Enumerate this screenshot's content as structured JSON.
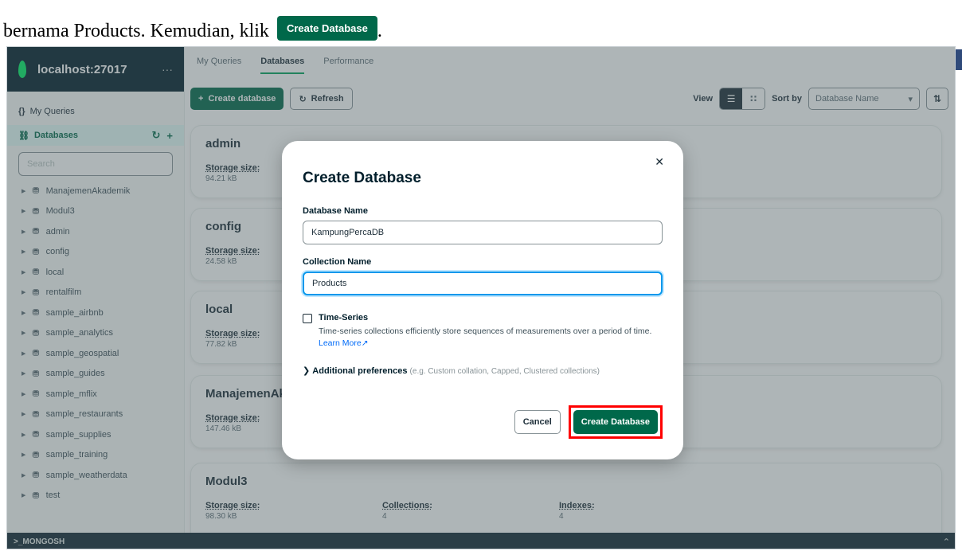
{
  "doc": {
    "line1": "",
    "line2_text": "bernama Products. Kemudian, klik",
    "inline_button": "Create Database",
    "line2_end": "."
  },
  "sidebar": {
    "connection": "localhost:27017",
    "connection_more": "···",
    "my_queries": "My Queries",
    "databases_label": "Databases",
    "search_placeholder": "Search",
    "databases": [
      "ManajemenAkademik",
      "Modul3",
      "admin",
      "config",
      "local",
      "rentalfilm",
      "sample_airbnb",
      "sample_analytics",
      "sample_geospatial",
      "sample_guides",
      "sample_mflix",
      "sample_restaurants",
      "sample_supplies",
      "sample_training",
      "sample_weatherdata",
      "test"
    ]
  },
  "tabs": [
    "My Queries",
    "Databases",
    "Performance"
  ],
  "toolbar": {
    "create": "Create database",
    "refresh": "Refresh",
    "view_label": "View",
    "sort_label": "Sort by",
    "sort_value": "Database Name"
  },
  "cards": [
    {
      "name": "admin",
      "storage_label": "Storage size:",
      "storage": "94.21 kB"
    },
    {
      "name": "config",
      "storage_label": "Storage size:",
      "storage": "24.58 kB"
    },
    {
      "name": "local",
      "storage_label": "Storage size:",
      "storage": "77.82 kB"
    },
    {
      "name": "ManajemenAk",
      "storage_label": "Storage size:",
      "storage": "147.46 kB"
    },
    {
      "name": "Modul3",
      "storage_label": "Storage size:",
      "storage": "98.30 kB",
      "collections_label": "Collections:",
      "collections": "4",
      "indexes_label": "Indexes:",
      "indexes": "4"
    }
  ],
  "mongosh": ">_MONGOSH",
  "modal": {
    "title": "Create Database",
    "db_name_label": "Database Name",
    "db_name_value": "KampungPercaDB",
    "coll_name_label": "Collection Name",
    "coll_name_value": "Products",
    "timeseries_label": "Time-Series",
    "timeseries_desc": "Time-series collections efficiently store sequences of measurements over a period of time.",
    "learn_more": "Learn More",
    "additional_label": "Additional preferences",
    "additional_hint": "(e.g. Custom collation, Capped, Clustered collections)",
    "cancel": "Cancel",
    "create": "Create Database"
  },
  "colors": {
    "brand_green": "#00684a",
    "leaf_green": "#00ed64",
    "dark_navy": "#001e2b",
    "highlight_red": "#ff0000",
    "focus_blue": "#0498ec"
  }
}
